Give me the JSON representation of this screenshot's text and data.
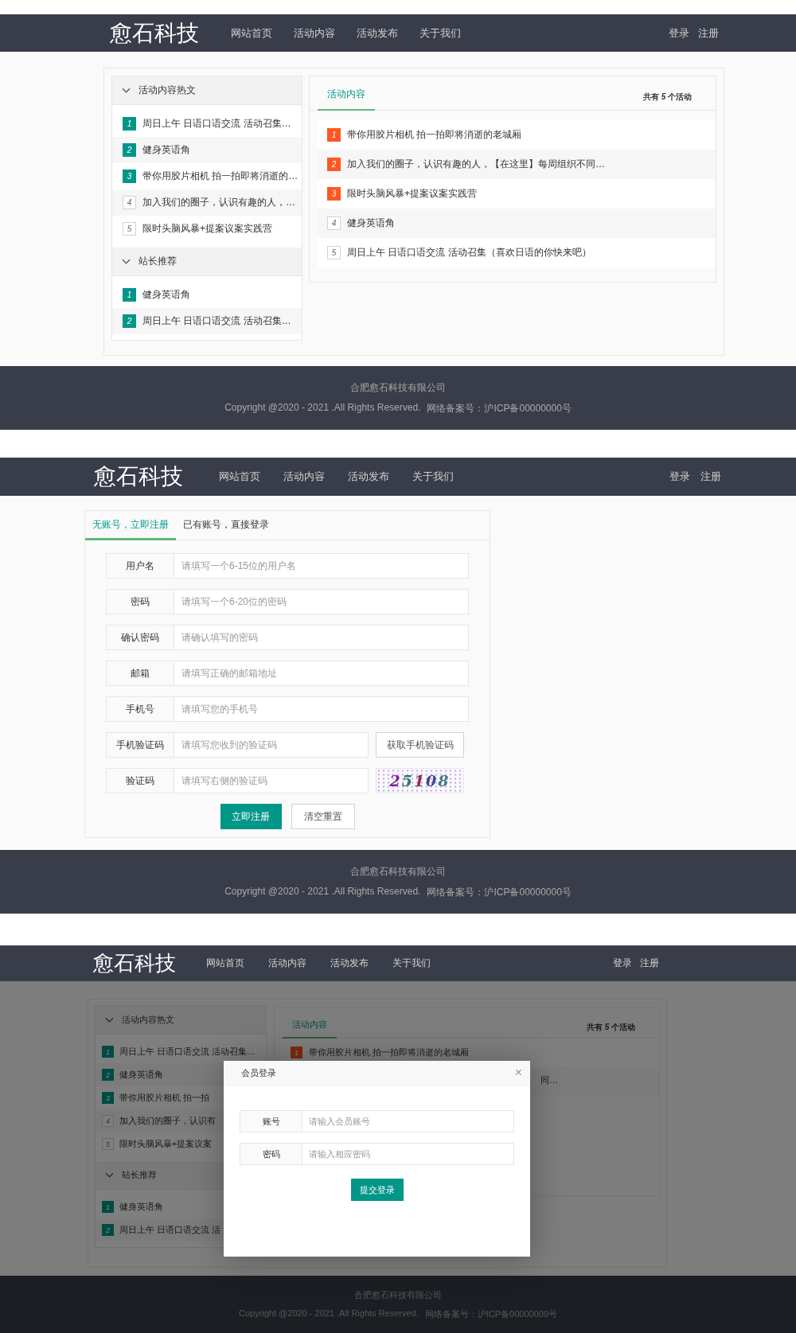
{
  "home_page": {
    "header": {
      "logo": "愈石科技",
      "nav": [
        "网站首页",
        "活动内容",
        "活动发布",
        "关于我们"
      ],
      "account_links": [
        "登录",
        "注册"
      ]
    },
    "sidebar": {
      "sections": [
        {
          "title": "活动内容热文",
          "expanded": true,
          "items": [
            {
              "rank": "1",
              "title": "周日上午 日语口语交流 活动召集…",
              "highlighted": true
            },
            {
              "rank": "2",
              "title": "健身英语角",
              "highlighted": true
            },
            {
              "rank": "3",
              "title": "带你用胶片相机 拍一拍即将消逝的…",
              "highlighted": true
            },
            {
              "rank": "4",
              "title": "加入我们的圈子，认识有趣的人，…",
              "highlighted": false
            },
            {
              "rank": "5",
              "title": "限时头脑风暴+提案议案实践营",
              "highlighted": false
            }
          ]
        },
        {
          "title": "站长推荐",
          "expanded": true,
          "items": [
            {
              "rank": "1",
              "title": "健身英语角",
              "highlighted": true
            },
            {
              "rank": "2",
              "title": "周日上午 日语口语交流 活动召集…",
              "highlighted": true
            }
          ]
        }
      ]
    },
    "content_panel": {
      "tabs": [
        {
          "label": "活动内容",
          "selected": true
        }
      ],
      "summary": "共有 *5* 个活动",
      "activities": [
        {
          "rank": "1",
          "title": "带你用胶片相机 拍一拍即将消逝的老城厢",
          "highlighted": true
        },
        {
          "rank": "2",
          "title": "加入我们的圈子，认识有趣的人，【在这里】每周组织不同…",
          "highlighted": true
        },
        {
          "rank": "3",
          "title": "限时头脑风暴+提案议案实践营",
          "highlighted": true
        },
        {
          "rank": "4",
          "title": "健身英语角",
          "highlighted": false
        },
        {
          "rank": "5",
          "title": "周日上午 日语口语交流 活动召集（喜欢日语的你快来吧）",
          "highlighted": false
        }
      ]
    },
    "footer": {
      "company": "合肥愈石科技有限公司",
      "copyright": "Copyright @2020 - 2021 .All Rights Reserved.",
      "record_number": "网络备案号：沪ICP备00000000号"
    }
  },
  "register_page": {
    "header": {
      "logo": "愈石科技",
      "nav": [
        "网站首页",
        "活动内容",
        "活动发布",
        "关于我们"
      ],
      "account_links": [
        "登录",
        "注册"
      ]
    },
    "tabs": [
      {
        "label": "无账号，立即注册",
        "selected": true
      },
      {
        "label": "已有账号，直接登录",
        "selected": false
      }
    ],
    "fields": [
      {
        "kind": "text",
        "label": "用户名",
        "placeholder": "请填写一个6-15位的用户名"
      },
      {
        "kind": "text",
        "label": "密码",
        "placeholder": "请填写一个6-20位的密码"
      },
      {
        "kind": "text",
        "label": "确认密码",
        "placeholder": "请确认填写的密码"
      },
      {
        "kind": "text",
        "label": "邮箱",
        "placeholder": "请填写正确的邮箱地址"
      },
      {
        "kind": "text",
        "label": "手机号",
        "placeholder": "请填写您的手机号"
      },
      {
        "kind": "sms",
        "label": "手机验证码",
        "placeholder": "请填写您收到的验证码",
        "button": "获取手机验证码"
      },
      {
        "kind": "captcha",
        "label": "验证码",
        "placeholder": "请填写右侧的验证码",
        "code": "25108"
      }
    ],
    "buttons": [
      {
        "kind": "primary",
        "label": "立即注册"
      },
      {
        "kind": "secondary",
        "label": "清空重置"
      }
    ],
    "footer": {
      "company": "合肥愈石科技有限公司",
      "copyright": "Copyright @2020 - 2021 .All Rights Reserved.",
      "record_number": "网络备案号：沪ICP备00000000号"
    }
  },
  "login_page": {
    "header": {
      "logo": "愈石科技",
      "nav": [
        "网站首页",
        "活动内容",
        "活动发布",
        "关于我们"
      ],
      "account_links": [
        "登录",
        "注册"
      ]
    },
    "sidebar": {
      "sections": [
        {
          "title": "活动内容热文",
          "expanded": true,
          "items": [
            {
              "rank": "1",
              "title": "周日上午 日语口语交流 活动召集…",
              "highlighted": true
            },
            {
              "rank": "2",
              "title": "健身英语角",
              "highlighted": true
            },
            {
              "rank": "3",
              "title": "带你用胶片相机 拍一拍",
              "highlighted": true
            },
            {
              "rank": "4",
              "title": "加入我们的圈子，认识有",
              "highlighted": false
            },
            {
              "rank": "5",
              "title": "限时头脑风暴+提案议案",
              "highlighted": false
            }
          ]
        },
        {
          "title": "站长推荐",
          "expanded": true,
          "items": [
            {
              "rank": "1",
              "title": "健身英语角",
              "highlighted": true
            },
            {
              "rank": "2",
              "title": "周日上午 日语口语交流 活",
              "highlighted": true
            }
          ]
        }
      ]
    },
    "content_panel": {
      "tabs": [
        {
          "label": "活动内容",
          "selected": true
        }
      ],
      "summary": "共有 *5* 个活动",
      "activities": [
        {
          "kind": "full",
          "rank": "1",
          "title": "带你用胶片相机 拍一拍即将消逝的老城厢",
          "highlighted": true
        },
        {
          "kind": "partial",
          "title": "同…"
        }
      ]
    },
    "dialog": {
      "title": "会员登录",
      "close": "×",
      "fields": [
        {
          "label": "账号",
          "placeholder": "请输入会员账号"
        },
        {
          "label": "密码",
          "placeholder": "请输入相应密码"
        }
      ],
      "submit": "提交登录"
    },
    "footer": {
      "company": "合肥愈石科技有限公司",
      "copyright": "Copyright @2020 - 2021 .All Rights Reserved.",
      "record_number": "网络备案号：沪ICP备00000000号"
    }
  }
}
